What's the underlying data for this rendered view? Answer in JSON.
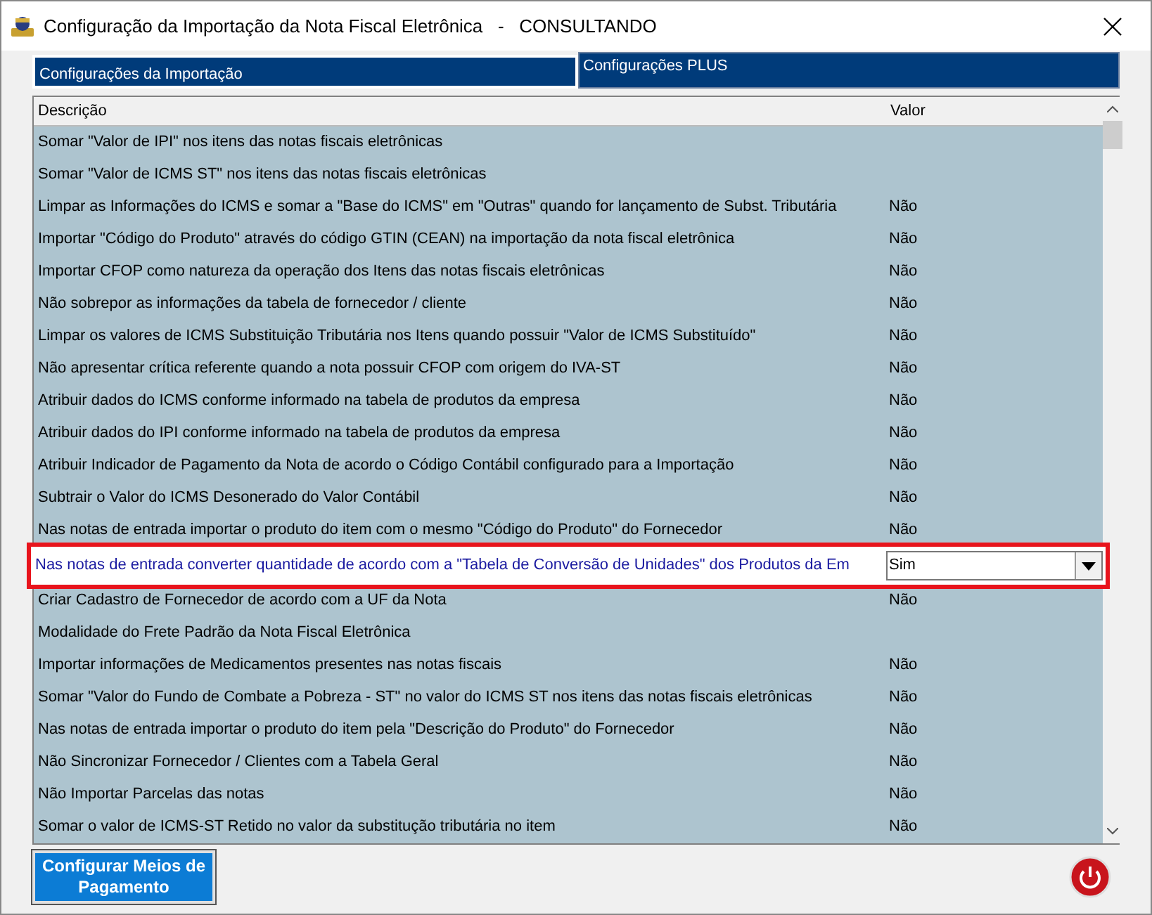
{
  "window": {
    "title": "Configuração da Importação da Nota Fiscal Eletrônica   -   CONSULTANDO"
  },
  "tabs": [
    {
      "label": "Configurações da Importação",
      "selected": true
    },
    {
      "label": "Configurações PLUS",
      "selected": false
    }
  ],
  "table": {
    "columns": [
      "Descrição",
      "Valor"
    ],
    "rows": [
      {
        "description": "Somar \"Valor de IPI\" nos itens das notas fiscais eletrônicas",
        "selected": false
      },
      {
        "description": "Somar \"Valor de ICMS ST\" nos itens das notas fiscais eletrônicas",
        "selected": false
      },
      {
        "description": "Limpar as Informações do ICMS e somar a \"Base do ICMS\" em \"Outras\" quando for lançamento de Subst. Tributária",
        "value": "Não",
        "selected": false
      },
      {
        "description": "Importar \"Código do Produto\" através do código GTIN (CEAN) na importação da nota fiscal eletrônica",
        "value": "Não",
        "selected": false
      },
      {
        "description": "Importar CFOP como natureza da operação dos Itens das notas fiscais eletrônicas",
        "value": "Não",
        "selected": false
      },
      {
        "description": "Não sobrepor as informações da tabela de fornecedor / cliente",
        "value": "Não",
        "selected": false
      },
      {
        "description": "Limpar os valores de ICMS Substituição Tributária nos Itens quando possuir \"Valor de ICMS Substituído\"",
        "value": "Não",
        "selected": false
      },
      {
        "description": "Não apresentar crítica referente quando a nota possuir CFOP com origem do IVA-ST",
        "value": "Não",
        "selected": false
      },
      {
        "description": "Atribuir dados do ICMS conforme informado na tabela de produtos da empresa",
        "value": "Não",
        "selected": false
      },
      {
        "description": "Atribuir dados do IPI conforme informado na tabela de produtos da empresa",
        "value": "Não",
        "selected": false
      },
      {
        "description": "Atribuir Indicador de Pagamento da Nota de acordo o Código Contábil configurado para a Importação",
        "value": "Não",
        "selected": false
      },
      {
        "description": "Subtrair o Valor do ICMS Desonerado do Valor Contábil",
        "value": "Não",
        "selected": false
      },
      {
        "description": "Nas notas de entrada importar o produto do item com o mesmo \"Código do Produto\" do Fornecedor",
        "value": "Não",
        "selected": false
      },
      {
        "description": "Nas notas de entrada converter quantidade de acordo com a \"Tabela de Conversão de Unidades\" dos Produtos da Em",
        "value": "Sim",
        "selected": true
      },
      {
        "description": "Criar Cadastro de Fornecedor de acordo com a UF da Nota",
        "value": "Não",
        "selected": false
      },
      {
        "description": "Modalidade do Frete Padrão da Nota Fiscal Eletrônica",
        "selected": false
      },
      {
        "description": "Importar informações de Medicamentos presentes nas notas fiscais",
        "value": "Não",
        "selected": false
      },
      {
        "description": "Somar \"Valor do Fundo de Combate a Pobreza - ST\" no valor do ICMS ST nos itens das notas fiscais eletrônicas",
        "value": "Não",
        "selected": false
      },
      {
        "description": "Nas notas de entrada importar o produto do item pela \"Descrição do Produto\" do Fornecedor",
        "value": "Não",
        "selected": false
      },
      {
        "description": "Não Sincronizar Fornecedor / Clientes com a Tabela Geral",
        "value": "Não",
        "selected": false
      },
      {
        "description": "Não Importar Parcelas das notas",
        "value": "Não",
        "selected": false
      },
      {
        "description": "Somar o valor de ICMS-ST Retido no valor da substitução tributária no item",
        "value": "Não",
        "selected": false
      }
    ]
  },
  "buttons": {
    "payment": "Configurar Meios de Pagamento"
  }
}
